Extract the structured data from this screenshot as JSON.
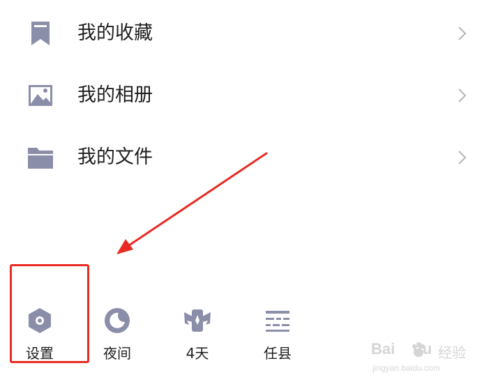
{
  "menu": {
    "items": [
      {
        "label": "我的收藏",
        "icon": "bookmark-icon"
      },
      {
        "label": "我的相册",
        "icon": "image-icon"
      },
      {
        "label": "我的文件",
        "icon": "folder-icon"
      }
    ]
  },
  "bottom_bar": {
    "items": [
      {
        "label": "设置",
        "icon": "hexagon-settings-icon"
      },
      {
        "label": "夜间",
        "icon": "moon-icon"
      },
      {
        "label": "4天",
        "icon": "winged-badge-icon"
      },
      {
        "label": "任县",
        "icon": "lines-icon"
      }
    ]
  },
  "annotation": {
    "highlight_target": "设置",
    "color": "#e82a22"
  },
  "watermark": {
    "brand_latin": "Bai",
    "brand_latin_end": "du",
    "brand_suffix": "经验",
    "url": "jingyan.baidu.com"
  },
  "colors": {
    "icon": "#8b8ea8",
    "text": "#1e1e1e",
    "chevron": "#b5b5b5",
    "annotation": "#e82a22",
    "watermark": "#d5d5d5"
  }
}
